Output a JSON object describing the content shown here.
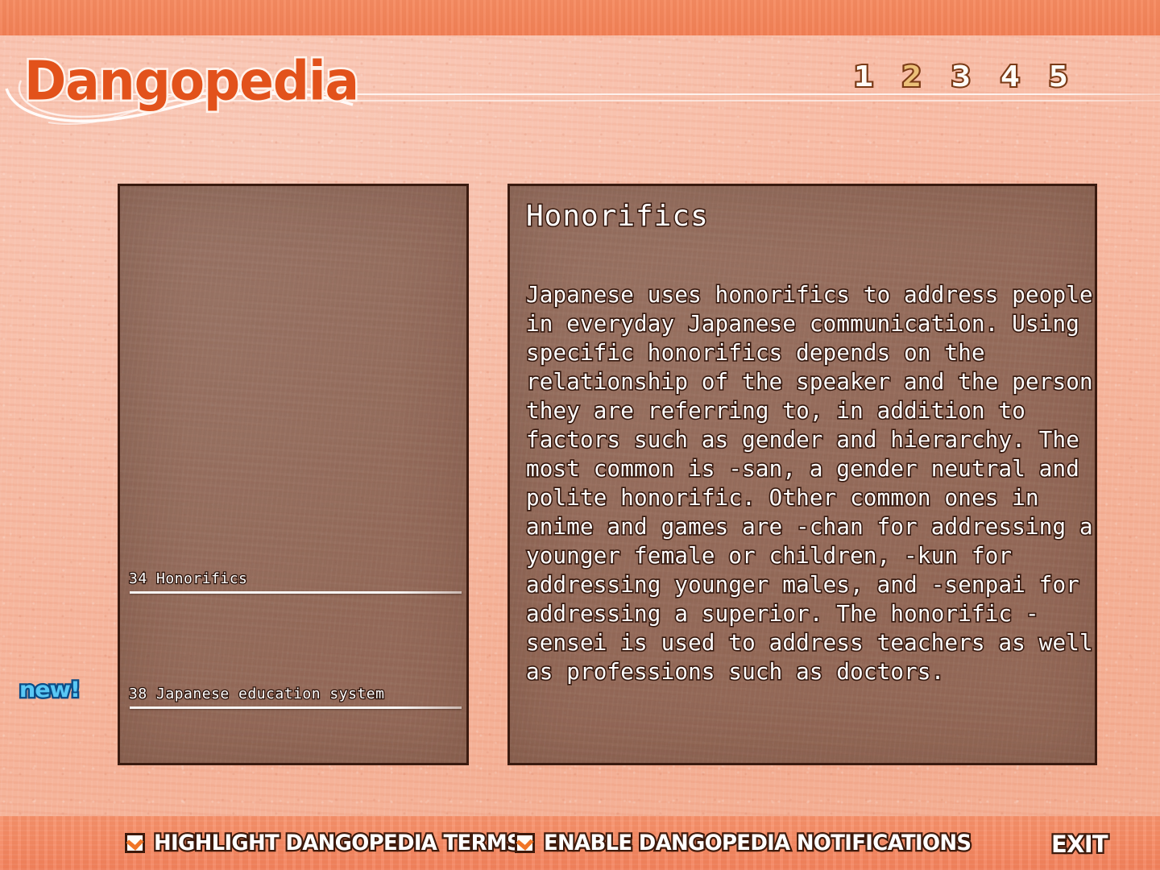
{
  "app": {
    "title": "Dangopedia"
  },
  "header": {
    "logo_text": "Dangopedia",
    "pages": [
      {
        "label": "1",
        "active": false
      },
      {
        "label": "2",
        "active": true
      },
      {
        "label": "3",
        "active": false
      },
      {
        "label": "4",
        "active": false
      },
      {
        "label": "5",
        "active": false
      }
    ]
  },
  "index_panel": {
    "new_badge": "new!",
    "entries": [
      {
        "number": "34",
        "title": "Honorifics",
        "label": "34 Honorifics"
      },
      {
        "number": "38",
        "title": "Japanese education system",
        "label": "38 Japanese education system"
      }
    ]
  },
  "article": {
    "title": "Honorifics",
    "body": "Japanese uses honorifics to address people in everyday Japanese communication. Using specific honorifics depends on the relationship of the speaker and the person they are referring to, in addition to factors such as gender and hierarchy. The most common is -san, a gender neutral and polite honorific. Other common ones in anime and games are -chan for addressing a younger female or children, -kun for addressing younger males, and -senpai for addressing a superior. The honorific -sensei is used to address teachers as well as professions such as doctors."
  },
  "bottom_bar": {
    "highlight_terms": {
      "label": "HIGHLIGHT DANGOPEDIA TERMS",
      "checked": true
    },
    "enable_notifications": {
      "label": "ENABLE DANGOPEDIA NOTIFICATIONS",
      "checked": true
    },
    "exit": {
      "label": "EXIT"
    }
  },
  "colors": {
    "background": "#F7B9A2",
    "bar": "#F28055",
    "logo_fill": "#E2521B",
    "logo_outline": "#FFF3EC",
    "panel_fill": "#765446",
    "panel_border": "#3A1B10",
    "page_active": "#EBC078",
    "page_inactive": "#FFFCF7",
    "new_badge": "#59C8F5",
    "check_tick": "#F07527"
  }
}
